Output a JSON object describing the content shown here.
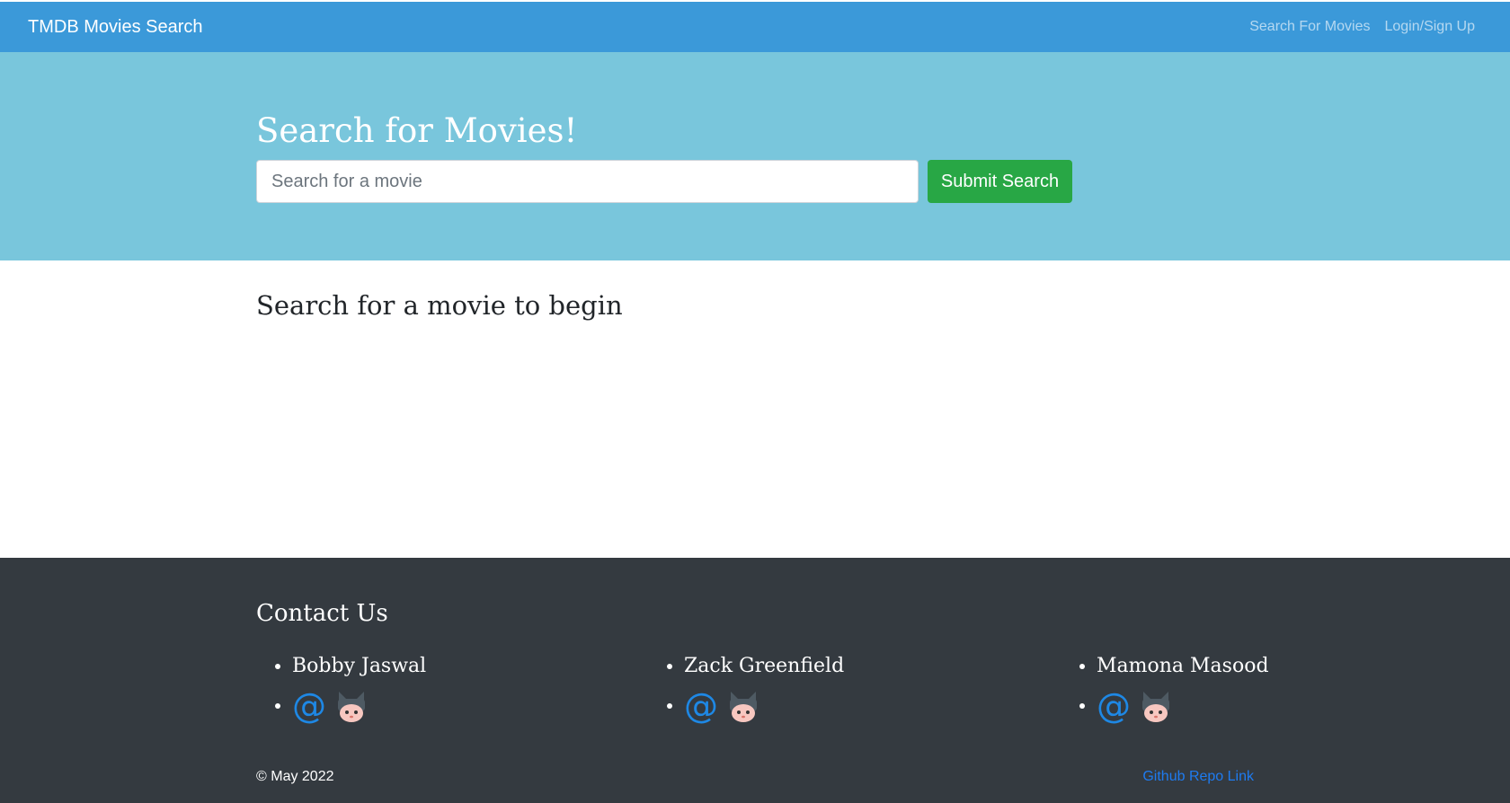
{
  "navbar": {
    "brand": "TMDB Movies Search",
    "links": [
      "Search For Movies",
      "Login/Sign Up"
    ],
    "background": "#3b99d9"
  },
  "hero": {
    "title": "Search for Movies!",
    "search_placeholder": "Search for a movie",
    "search_value": "",
    "submit_label": "Submit Search",
    "background": "#79c6dc",
    "button_color": "#28a745"
  },
  "main": {
    "prompt": "Search for a movie to begin"
  },
  "footer": {
    "title": "Contact Us",
    "contacts": [
      {
        "name": "Bobby Jaswal",
        "icons": [
          "at-icon",
          "github-octocat-icon"
        ]
      },
      {
        "name": "Zack Greenfield",
        "icons": [
          "at-icon",
          "github-octocat-icon"
        ]
      },
      {
        "name": "Mamona Masood",
        "icons": [
          "at-icon",
          "github-octocat-icon"
        ]
      }
    ],
    "at_symbol": "@",
    "copyright": "© May 2022",
    "repo_link": "Github Repo Link",
    "background": "#343a40",
    "link_color": "#1e7bf0"
  }
}
